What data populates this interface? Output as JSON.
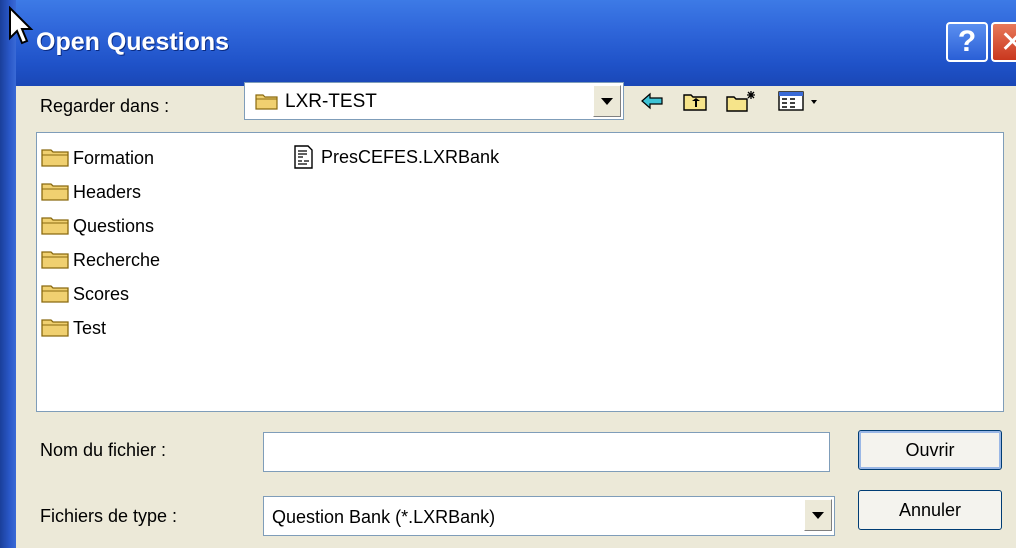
{
  "window": {
    "title": "Open Questions",
    "help_glyph": "?",
    "close_glyph": "✕"
  },
  "lookin": {
    "label": "Regarder dans :",
    "value": "LXR-TEST"
  },
  "toolbar": {
    "icons": [
      "back-icon",
      "up-folder-icon",
      "new-folder-icon",
      "view-menu-icon"
    ]
  },
  "files": {
    "folders": [
      "Formation",
      "Headers",
      "Questions",
      "Recherche",
      "Scores",
      "Test"
    ],
    "documents": [
      "PresCEFES.LXRBank"
    ]
  },
  "filename": {
    "label": "Nom du fichier :",
    "value": ""
  },
  "filetype": {
    "label": "Fichiers de type :",
    "value": "Question Bank (*.LXRBank)"
  },
  "buttons": {
    "open": "Ouvrir",
    "cancel": "Annuler"
  },
  "colors": {
    "titlebar": "#2f66da",
    "dialog_bg": "#ece9d8",
    "folder": "#f0d070"
  }
}
